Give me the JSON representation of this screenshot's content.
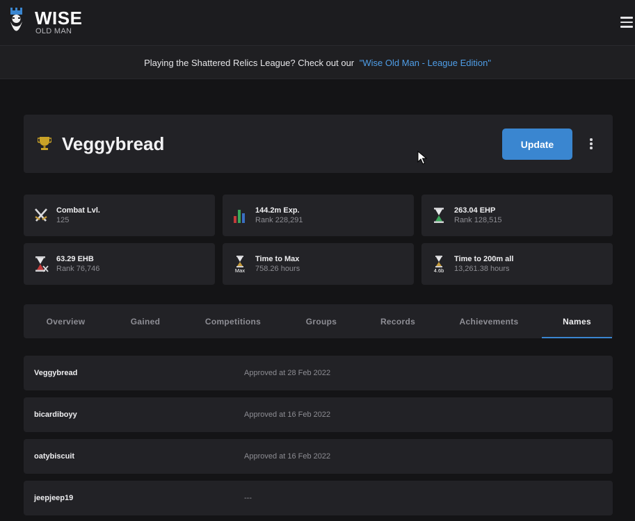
{
  "app": {
    "title": "WISE",
    "subtitle": "OLD MAN"
  },
  "banner": {
    "text": "Playing the Shattered Relics League? Check out our",
    "link_text": "\"Wise Old Man - League Edition\""
  },
  "player": {
    "name": "Veggybread",
    "update_label": "Update"
  },
  "stats": [
    {
      "title": "Combat Lvl.",
      "sub": "125",
      "icon": "crossed-swords-icon"
    },
    {
      "title": "144.2m Exp.",
      "sub": "Rank 228,291",
      "icon": "bar-chart-icon"
    },
    {
      "title": "263.04 EHP",
      "sub": "Rank 128,515",
      "icon": "hourglass-icon"
    },
    {
      "title": "63.29 EHB",
      "sub": "Rank 76,746",
      "icon": "hourglass-boss-icon"
    },
    {
      "title": "Time to Max",
      "sub": "758.26 hours",
      "icon": "hourglass-max-icon",
      "badge": "Max"
    },
    {
      "title": "Time to 200m all",
      "sub": "13,261.38 hours",
      "icon": "hourglass-200m-icon",
      "badge": "4.6b"
    }
  ],
  "tabs": [
    "Overview",
    "Gained",
    "Competitions",
    "Groups",
    "Records",
    "Achievements",
    "Names"
  ],
  "active_tab": "Names",
  "names": [
    {
      "name": "Veggybread",
      "status": "Approved at 28 Feb 2022"
    },
    {
      "name": "bicardiboyy",
      "status": "Approved at 16 Feb 2022"
    },
    {
      "name": "oatybiscuit",
      "status": "Approved at 16 Feb 2022"
    },
    {
      "name": "jeepjeep19",
      "status": "---"
    }
  ],
  "colors": {
    "accent": "#3a86d0",
    "link": "#4f9ee8",
    "background": "#141416",
    "card": "#222226"
  }
}
